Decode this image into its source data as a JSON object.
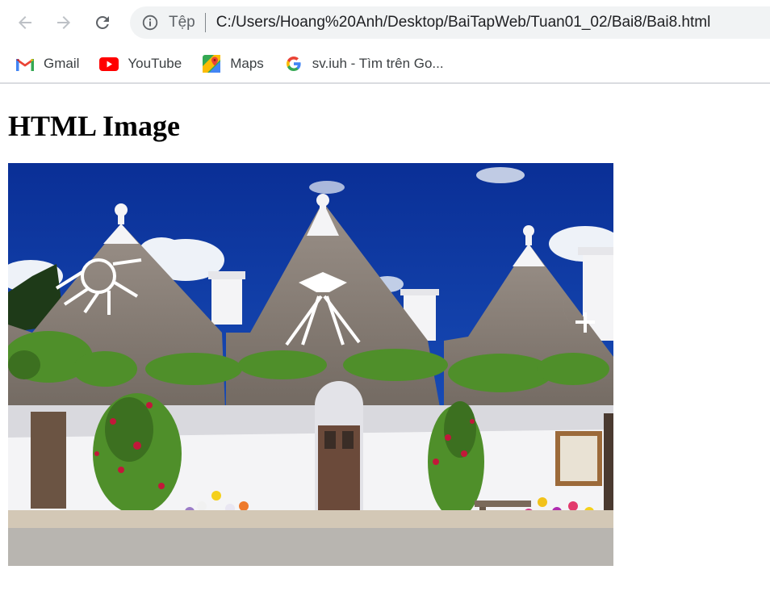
{
  "browser": {
    "back_icon": "arrow-left-icon",
    "forward_icon": "arrow-right-icon",
    "reload_icon": "reload-icon",
    "site_info_icon": "info-icon",
    "scheme_label": "Tệp",
    "url": "C:/Users/Hoang%20Anh/Desktop/BaiTapWeb/Tuan01_02/Bai8/Bai8.html"
  },
  "bookmarks": [
    {
      "label": "Gmail",
      "icon": "gmail-icon"
    },
    {
      "label": "YouTube",
      "icon": "youtube-icon"
    },
    {
      "label": "Maps",
      "icon": "maps-icon"
    },
    {
      "label": "sv.iuh - Tìm trên Go...",
      "icon": "google-icon"
    }
  ],
  "page": {
    "heading": "HTML Image"
  },
  "colors": {
    "sky": "#0b3aa8",
    "roof": "#8b8178",
    "wall": "#f4f4f6",
    "foliage": "#4f8f2a"
  }
}
